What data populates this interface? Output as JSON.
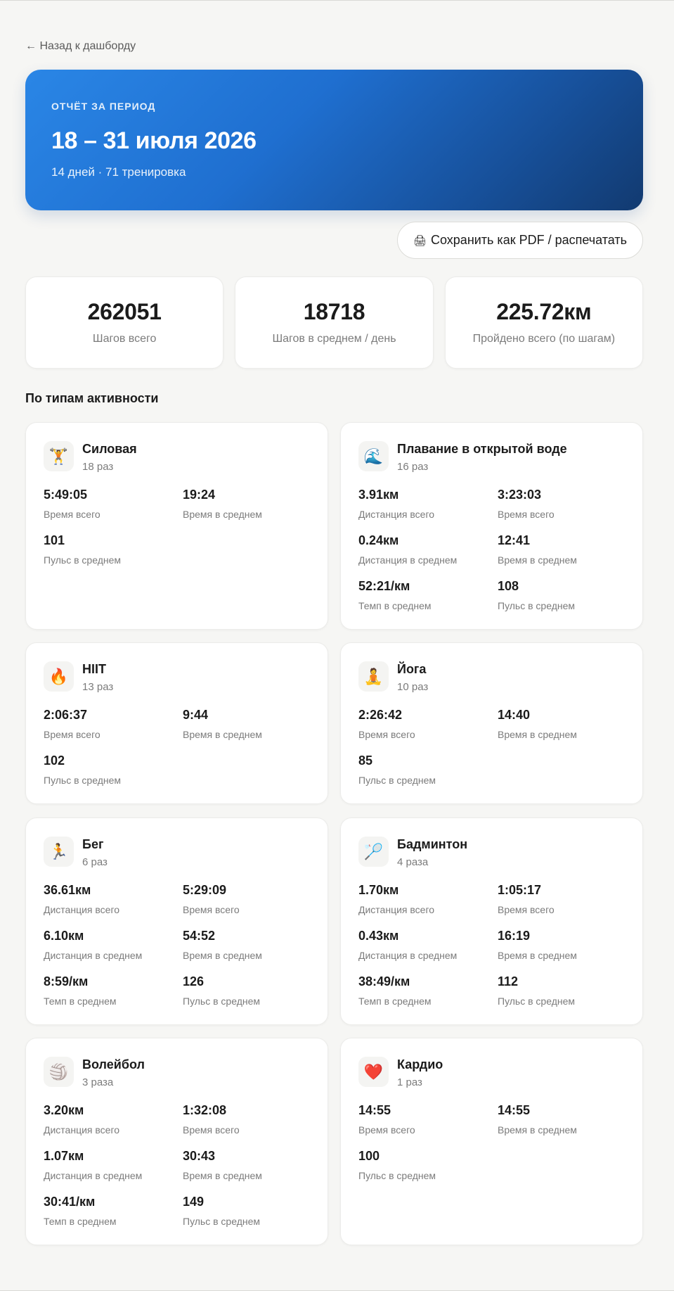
{
  "nav": {
    "back_label": "← Назад к дашборду"
  },
  "hero": {
    "eyebrow": "ОТЧЁТ ЗА ПЕРИОД",
    "title": "18 – 31 июля 2026",
    "subtitle": "14 дней · 71 тренировка"
  },
  "actions": {
    "print_icon": "🖨",
    "print_label": "Сохранить как PDF / распечатать"
  },
  "summary": [
    {
      "value": "262051",
      "label": "Шагов всего"
    },
    {
      "value": "18718",
      "label": "Шагов в среднем / день"
    },
    {
      "value": "225.72км",
      "label": "Пройдено всего (по шагам)"
    }
  ],
  "section_title": "По типам активности",
  "activities": [
    {
      "icon": "🏋️",
      "icon_name": "weightlifting-icon",
      "name": "Силовая",
      "count": "18 раз",
      "metrics": [
        {
          "value": "5:49:05",
          "label": "Время всего"
        },
        {
          "value": "19:24",
          "label": "Время в среднем"
        },
        {
          "value": "101",
          "label": "Пульс в среднем"
        }
      ]
    },
    {
      "icon": "🌊",
      "icon_name": "open-water-swim-icon",
      "name": "Плавание в открытой воде",
      "count": "16 раз",
      "metrics": [
        {
          "value": "3.91км",
          "label": "Дистанция всего"
        },
        {
          "value": "3:23:03",
          "label": "Время всего"
        },
        {
          "value": "0.24км",
          "label": "Дистанция в среднем"
        },
        {
          "value": "12:41",
          "label": "Время в среднем"
        },
        {
          "value": "52:21/км",
          "label": "Темп в среднем"
        },
        {
          "value": "108",
          "label": "Пульс в среднем"
        }
      ]
    },
    {
      "icon": "🔥",
      "icon_name": "fire-icon",
      "name": "HIIT",
      "count": "13 раз",
      "metrics": [
        {
          "value": "2:06:37",
          "label": "Время всего"
        },
        {
          "value": "9:44",
          "label": "Время в среднем"
        },
        {
          "value": "102",
          "label": "Пульс в среднем"
        }
      ]
    },
    {
      "icon": "🧘",
      "icon_name": "yoga-icon",
      "name": "Йога",
      "count": "10 раз",
      "metrics": [
        {
          "value": "2:26:42",
          "label": "Время всего"
        },
        {
          "value": "14:40",
          "label": "Время в среднем"
        },
        {
          "value": "85",
          "label": "Пульс в среднем"
        }
      ]
    },
    {
      "icon": "🏃",
      "icon_name": "running-icon",
      "name": "Бег",
      "count": "6 раз",
      "metrics": [
        {
          "value": "36.61км",
          "label": "Дистанция всего"
        },
        {
          "value": "5:29:09",
          "label": "Время всего"
        },
        {
          "value": "6.10км",
          "label": "Дистанция в среднем"
        },
        {
          "value": "54:52",
          "label": "Время в среднем"
        },
        {
          "value": "8:59/км",
          "label": "Темп в среднем"
        },
        {
          "value": "126",
          "label": "Пульс в среднем"
        }
      ]
    },
    {
      "icon": "🏸",
      "icon_name": "badminton-icon",
      "name": "Бадминтон",
      "count": "4 раза",
      "metrics": [
        {
          "value": "1.70км",
          "label": "Дистанция всего"
        },
        {
          "value": "1:05:17",
          "label": "Время всего"
        },
        {
          "value": "0.43км",
          "label": "Дистанция в среднем"
        },
        {
          "value": "16:19",
          "label": "Время в среднем"
        },
        {
          "value": "38:49/км",
          "label": "Темп в среднем"
        },
        {
          "value": "112",
          "label": "Пульс в среднем"
        }
      ]
    },
    {
      "icon": "🏐",
      "icon_name": "volleyball-icon",
      "name": "Волейбол",
      "count": "3 раза",
      "metrics": [
        {
          "value": "3.20км",
          "label": "Дистанция всего"
        },
        {
          "value": "1:32:08",
          "label": "Время всего"
        },
        {
          "value": "1.07км",
          "label": "Дистанция в среднем"
        },
        {
          "value": "30:43",
          "label": "Время в среднем"
        },
        {
          "value": "30:41/км",
          "label": "Темп в среднем"
        },
        {
          "value": "149",
          "label": "Пульс в среднем"
        }
      ]
    },
    {
      "icon": "❤️",
      "icon_name": "heart-icon",
      "name": "Кардио",
      "count": "1 раз",
      "metrics": [
        {
          "value": "14:55",
          "label": "Время всего"
        },
        {
          "value": "14:55",
          "label": "Время в среднем"
        },
        {
          "value": "100",
          "label": "Пульс в среднем"
        }
      ]
    }
  ]
}
